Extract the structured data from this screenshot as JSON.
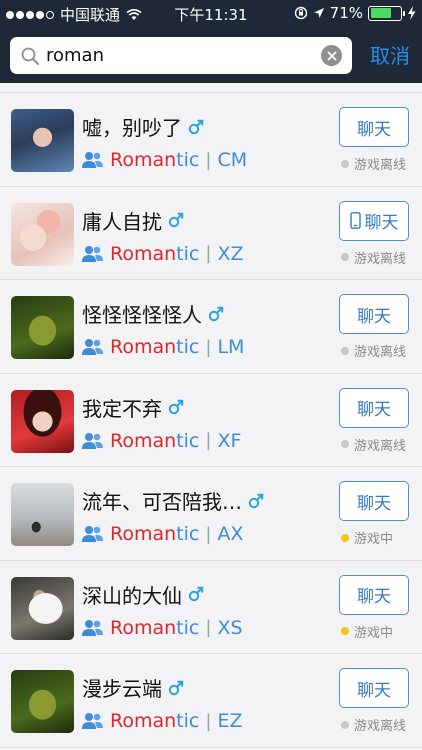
{
  "status_bar": {
    "carrier": "中国联通",
    "time": "下午11:31",
    "battery": "71%",
    "battery_level": 0.71
  },
  "search": {
    "value": "roman",
    "cancel_label": "取消"
  },
  "colors": {
    "header_bg": "#1f2836",
    "accent": "#2d8cf0",
    "match_red": "#e0252a",
    "group_blue": "#3e8bd8",
    "ingame_yellow": "#f5c518",
    "offline_gray": "#c8c8c8"
  },
  "results": [
    {
      "name": "嘘，别吵了",
      "gender": "male-icon",
      "group_match": "Roman",
      "group_rest": "tic",
      "abbr": "CM",
      "button_label": "聊天",
      "button_icon": "",
      "status": "游戏离线",
      "status_state": "offline"
    },
    {
      "name": "庸人自扰",
      "gender": "male-icon",
      "group_match": "Roman",
      "group_rest": "tic",
      "abbr": "XZ",
      "button_label": "聊天",
      "button_icon": "phone-icon",
      "status": "游戏离线",
      "status_state": "offline"
    },
    {
      "name": "怪怪怪怪怪人",
      "gender": "male-icon",
      "group_match": "Roman",
      "group_rest": "tic",
      "abbr": "LM",
      "button_label": "聊天",
      "button_icon": "",
      "status": "游戏离线",
      "status_state": "offline"
    },
    {
      "name": "我定不弃",
      "gender": "male-icon",
      "group_match": "Roman",
      "group_rest": "tic",
      "abbr": "XF",
      "button_label": "聊天",
      "button_icon": "",
      "status": "游戏离线",
      "status_state": "offline"
    },
    {
      "name": "流年、可否陪我…",
      "gender": "male-icon",
      "group_match": "Roman",
      "group_rest": "tic",
      "abbr": "AX",
      "button_label": "聊天",
      "button_icon": "",
      "status": "游戏中",
      "status_state": "ingame"
    },
    {
      "name": "深山的大仙",
      "gender": "male-icon",
      "group_match": "Roman",
      "group_rest": "tic",
      "abbr": "XS",
      "button_label": "聊天",
      "button_icon": "",
      "status": "游戏中",
      "status_state": "ingame"
    },
    {
      "name": "漫步云端",
      "gender": "male-icon",
      "group_match": "Roman",
      "group_rest": "tic",
      "abbr": "EZ",
      "button_label": "聊天",
      "button_icon": "",
      "status": "游戏离线",
      "status_state": "offline"
    }
  ]
}
